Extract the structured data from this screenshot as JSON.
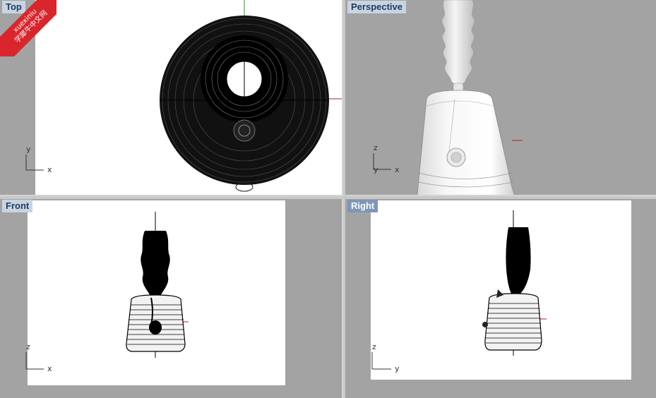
{
  "viewports": {
    "top": {
      "label": "Top"
    },
    "perspective": {
      "label": "Perspective"
    },
    "front": {
      "label": "Front"
    },
    "right": {
      "label": "Right"
    }
  },
  "axes": {
    "top": {
      "horizontal": "x",
      "vertical": "y"
    },
    "perspective": {
      "horizontal": "x",
      "vertical": "z",
      "depth": "y"
    },
    "front": {
      "horizontal": "x",
      "vertical": "z"
    },
    "right": {
      "horizontal": "y",
      "vertical": "z"
    }
  },
  "watermark": {
    "line1": "xuexiniu",
    "line2": "学犀牛中文网"
  },
  "colors": {
    "viewport_bg": "#a3a3a3",
    "page_bg": "#ffffff",
    "x_axis": "#b22222",
    "y_axis": "#228b22",
    "active_label": "#7f96b8"
  }
}
